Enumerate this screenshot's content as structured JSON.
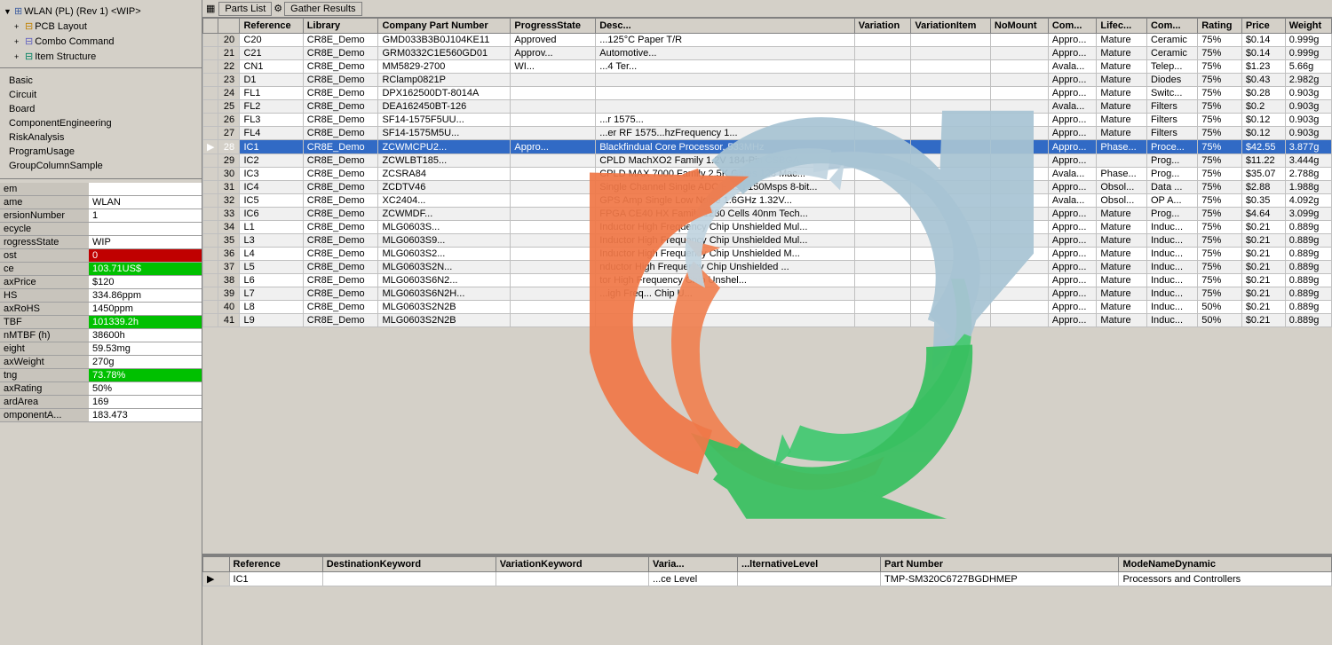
{
  "sidebar": {
    "tree": [
      {
        "label": "WLAN (PL) (Rev 1) <WIP>",
        "level": 0,
        "expanded": true
      },
      {
        "label": "PCB Layout",
        "level": 1,
        "icon": "pcb"
      },
      {
        "label": "Combo Command",
        "level": 1,
        "icon": "combo"
      },
      {
        "label": "Item Structure",
        "level": 1,
        "icon": "item"
      }
    ],
    "nav": [
      {
        "label": "Basic"
      },
      {
        "label": "Circuit"
      },
      {
        "label": "Board"
      },
      {
        "label": "ComponentEngineering"
      },
      {
        "label": "RiskAnalysis"
      },
      {
        "label": "ProgramUsage"
      },
      {
        "label": "GroupColumnSample"
      }
    ],
    "props": [
      {
        "key": "em",
        "value": ""
      },
      {
        "key": "ame",
        "value": "WLAN"
      },
      {
        "key": "ersionNumber",
        "value": "1"
      },
      {
        "key": "ecycle",
        "value": ""
      },
      {
        "key": "rogressState",
        "value": "WIP"
      },
      {
        "key": "ost",
        "value": "0",
        "color": "red"
      },
      {
        "key": "ce",
        "value": "103.71US$",
        "color": "green"
      },
      {
        "key": "axPrice",
        "value": "$120"
      },
      {
        "key": "HS",
        "value": "334.86ppm"
      },
      {
        "key": "axRoHS",
        "value": "1450ppm"
      },
      {
        "key": "TBF",
        "value": "101339.2h",
        "color": "green"
      },
      {
        "key": "nMTBF (h)",
        "value": "38600h"
      },
      {
        "key": "eight",
        "value": "59.53mg"
      },
      {
        "key": "axWeight",
        "value": "270g"
      },
      {
        "key": "tng",
        "value": "73.78%",
        "color": "green"
      },
      {
        "key": "axRating",
        "value": "50%"
      },
      {
        "key": "ardArea",
        "value": "169"
      },
      {
        "key": "omponentA...",
        "value": "183.473"
      }
    ]
  },
  "toolbar": {
    "parts_list_label": "Parts List",
    "gather_results_label": "Gather Results"
  },
  "top_table": {
    "columns": [
      "",
      "Reference",
      "Library",
      "Company Part Number",
      "ProgressState",
      "Desc...",
      "Variation",
      "VariationItem",
      "NoMount",
      "Com...",
      "Lifec...",
      "Com...",
      "Rating",
      "Price",
      "Weight"
    ],
    "rows": [
      {
        "num": "20",
        "ref": "C20",
        "lib": "CR8E_Demo",
        "cpn": "GMD033B3B0J104KE11",
        "state": "Approved",
        "desc": "...125°C Paper T/R",
        "variation": "",
        "varitem": "",
        "nomount": "",
        "com": "Appro...",
        "life": "Mature",
        "comp": "Ceramic",
        "rating": "75%",
        "price": "$0.14",
        "weight": "0.999g"
      },
      {
        "num": "21",
        "ref": "C21",
        "lib": "CR8E_Demo",
        "cpn": "GRM0332C1E560GD01",
        "state": "Approv...",
        "desc": "Automotive...",
        "variation": "",
        "varitem": "",
        "nomount": "",
        "com": "Appro...",
        "life": "Mature",
        "comp": "Ceramic",
        "rating": "75%",
        "price": "$0.14",
        "weight": "0.999g"
      },
      {
        "num": "22",
        "ref": "CN1",
        "lib": "CR8E_Demo",
        "cpn": "MM5829-2700",
        "state": "WI...",
        "desc": "...4 Ter...",
        "variation": "",
        "varitem": "",
        "nomount": "",
        "com": "Avala...",
        "life": "Mature",
        "comp": "Telep...",
        "rating": "75%",
        "price": "$1.23",
        "weight": "5.66g"
      },
      {
        "num": "23",
        "ref": "D1",
        "lib": "CR8E_Demo",
        "cpn": "RClamp0821P",
        "state": "",
        "desc": "",
        "variation": "",
        "varitem": "",
        "nomount": "",
        "com": "Appro...",
        "life": "Mature",
        "comp": "Diodes",
        "rating": "75%",
        "price": "$0.43",
        "weight": "2.982g"
      },
      {
        "num": "24",
        "ref": "FL1",
        "lib": "CR8E_Demo",
        "cpn": "DPX162500DT-8014A",
        "state": "",
        "desc": "",
        "variation": "",
        "varitem": "",
        "nomount": "",
        "com": "Appro...",
        "life": "Mature",
        "comp": "Switc...",
        "rating": "75%",
        "price": "$0.28",
        "weight": "0.903g"
      },
      {
        "num": "25",
        "ref": "FL2",
        "lib": "CR8E_Demo",
        "cpn": "DEA162450BT-126",
        "state": "",
        "desc": "",
        "variation": "",
        "varitem": "",
        "nomount": "",
        "com": "Avala...",
        "life": "Mature",
        "comp": "Filters",
        "rating": "75%",
        "price": "$0.2",
        "weight": "0.903g"
      },
      {
        "num": "26",
        "ref": "FL3",
        "lib": "CR8E_Demo",
        "cpn": "SF14-1575F5UU...",
        "state": "",
        "desc": "...r 1575...",
        "variation": "",
        "varitem": "",
        "nomount": "",
        "com": "Appro...",
        "life": "Mature",
        "comp": "Filters",
        "rating": "75%",
        "price": "$0.12",
        "weight": "0.903g"
      },
      {
        "num": "27",
        "ref": "FL4",
        "lib": "CR8E_Demo",
        "cpn": "SF14-1575M5U...",
        "state": "",
        "desc": "...er RF 1575...hzFrequency 1...",
        "variation": "",
        "varitem": "",
        "nomount": "",
        "com": "Appro...",
        "life": "Mature",
        "comp": "Filters",
        "rating": "75%",
        "price": "$0.12",
        "weight": "0.903g"
      },
      {
        "num": "28",
        "ref": "IC1",
        "lib": "CR8E_Demo",
        "cpn": "ZCWMCPU2...",
        "state": "Appro...",
        "desc": "Blackfindual Core Processor, 533MHz",
        "variation": "",
        "varitem": "",
        "nomount": "",
        "com": "Appro...",
        "life": "Phase...",
        "comp": "Proce...",
        "rating": "75%",
        "price": "$42.55",
        "weight": "3.877g",
        "selected": true
      },
      {
        "num": "29",
        "ref": "IC2",
        "lib": "CR8E_Demo",
        "cpn": "ZCWLBT185...",
        "state": "",
        "desc": "CPLD MachXO2 Family 1.2V 184-Pin CSBGA...",
        "variation": "",
        "varitem": "",
        "nomount": "",
        "com": "Appro...",
        "life": "",
        "comp": "Prog...",
        "rating": "75%",
        "price": "$11.22",
        "weight": "3.444g"
      },
      {
        "num": "30",
        "ref": "IC3",
        "lib": "CR8E_Demo",
        "cpn": "ZCSRA84",
        "state": "",
        "desc": "CPLD MAX 7000 Family 2.5K Gates 128 Mac...",
        "variation": "",
        "varitem": "",
        "nomount": "",
        "com": "Avala...",
        "life": "Phase...",
        "comp": "Prog...",
        "rating": "75%",
        "price": "$35.07",
        "weight": "2.788g"
      },
      {
        "num": "31",
        "ref": "IC4",
        "lib": "CR8E_Demo",
        "cpn": "ZCDTV46",
        "state": "",
        "desc": "Single Channel Single ADC Flash 150Msps 8-bit...",
        "variation": "",
        "varitem": "",
        "nomount": "",
        "com": "Appro...",
        "life": "Obsol...",
        "comp": "Data ...",
        "rating": "75%",
        "price": "$2.88",
        "weight": "1.988g"
      },
      {
        "num": "32",
        "ref": "IC5",
        "lib": "CR8E_Demo",
        "cpn": "XC2404...",
        "state": "",
        "desc": "GPS Amp Single Low Noise 1.6GHz 1.32V...",
        "variation": "",
        "varitem": "",
        "nomount": "",
        "com": "Avala...",
        "life": "Obsol...",
        "comp": "OP A...",
        "rating": "75%",
        "price": "$0.35",
        "weight": "4.092g"
      },
      {
        "num": "33",
        "ref": "IC6",
        "lib": "CR8E_Demo",
        "cpn": "ZCWMDF...",
        "state": "",
        "desc": "FPGA CE40 HX Family 1280 Cells 40nm Tech...",
        "variation": "",
        "varitem": "",
        "nomount": "",
        "com": "Appro...",
        "life": "Mature",
        "comp": "Prog...",
        "rating": "75%",
        "price": "$4.64",
        "weight": "3.099g"
      },
      {
        "num": "34",
        "ref": "L1",
        "lib": "CR8E_Demo",
        "cpn": "MLG0603S...",
        "state": "",
        "desc": "Inductor High Frequency Chip Unshielded Mul...",
        "variation": "",
        "varitem": "",
        "nomount": "",
        "com": "Appro...",
        "life": "Mature",
        "comp": "Induc...",
        "rating": "75%",
        "price": "$0.21",
        "weight": "0.889g"
      },
      {
        "num": "35",
        "ref": "L3",
        "lib": "CR8E_Demo",
        "cpn": "MLG0603S9...",
        "state": "",
        "desc": "Inductor High Frequency Chip Unshielded Mul...",
        "variation": "",
        "varitem": "",
        "nomount": "",
        "com": "Appro...",
        "life": "Mature",
        "comp": "Induc...",
        "rating": "75%",
        "price": "$0.21",
        "weight": "0.889g"
      },
      {
        "num": "36",
        "ref": "L4",
        "lib": "CR8E_Demo",
        "cpn": "MLG0603S2...",
        "state": "",
        "desc": "Inductor High Frequency Chip Unshielded M...",
        "variation": "",
        "varitem": "",
        "nomount": "",
        "com": "Appro...",
        "life": "Mature",
        "comp": "Induc...",
        "rating": "75%",
        "price": "$0.21",
        "weight": "0.889g"
      },
      {
        "num": "37",
        "ref": "L5",
        "lib": "CR8E_Demo",
        "cpn": "MLG0603S2N...",
        "state": "",
        "desc": "nductor High Frequency Chip Unshielded ...",
        "variation": "",
        "varitem": "",
        "nomount": "",
        "com": "Appro...",
        "life": "Mature",
        "comp": "Induc...",
        "rating": "75%",
        "price": "$0.21",
        "weight": "0.889g"
      },
      {
        "num": "38",
        "ref": "L6",
        "lib": "CR8E_Demo",
        "cpn": "MLG0603S6N2...",
        "state": "",
        "desc": "tor High Frequency Chip Unshel...",
        "variation": "",
        "varitem": "",
        "nomount": "",
        "com": "Appro...",
        "life": "Mature",
        "comp": "Induc...",
        "rating": "75%",
        "price": "$0.21",
        "weight": "0.889g"
      },
      {
        "num": "39",
        "ref": "L7",
        "lib": "CR8E_Demo",
        "cpn": "MLG0603S6N2H...",
        "state": "",
        "desc": "...igh Freq... Chip U...",
        "variation": "",
        "varitem": "",
        "nomount": "",
        "com": "Appro...",
        "life": "Mature",
        "comp": "Induc...",
        "rating": "75%",
        "price": "$0.21",
        "weight": "0.889g"
      },
      {
        "num": "40",
        "ref": "L8",
        "lib": "CR8E_Demo",
        "cpn": "MLG0603S2N2B",
        "state": "",
        "desc": "",
        "variation": "",
        "varitem": "",
        "nomount": "",
        "com": "Appro...",
        "life": "Mature",
        "comp": "Induc...",
        "rating": "50%",
        "price": "$0.21",
        "weight": "0.889g"
      },
      {
        "num": "41",
        "ref": "L9",
        "lib": "CR8E_Demo",
        "cpn": "MLG0603S2N2B",
        "state": "",
        "desc": "",
        "variation": "",
        "varitem": "",
        "nomount": "",
        "com": "Appro...",
        "life": "Mature",
        "comp": "Induc...",
        "rating": "50%",
        "price": "$0.21",
        "weight": "0.889g"
      }
    ]
  },
  "bottom_table": {
    "columns": [
      "",
      "Reference",
      "DestinationKeyword",
      "VariationKeyword",
      "Varia...",
      "...lternativeLevel",
      "Part Number",
      "ModeNameDynamic"
    ],
    "rows": [
      {
        "arrow": "▶",
        "ref": "IC1",
        "dest": "",
        "varkw": "",
        "varia": "...ce Level",
        "altlevel": "",
        "partnum": "TMP-SM320C6727BGDHMEP",
        "mode": "Processors and Controllers"
      }
    ]
  }
}
